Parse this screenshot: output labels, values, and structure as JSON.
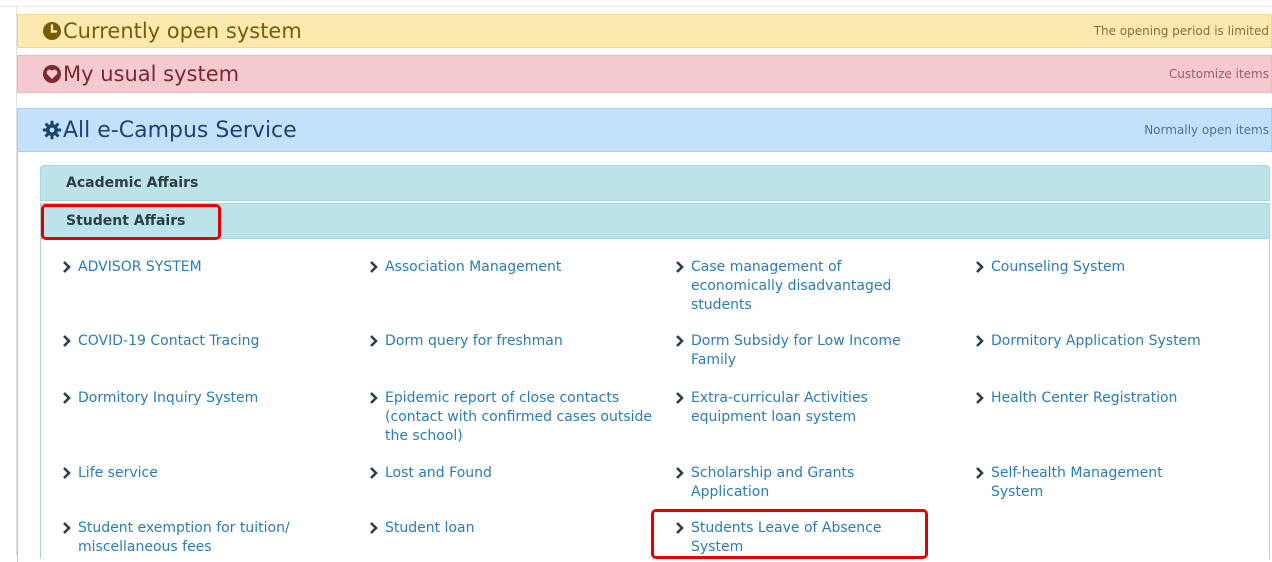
{
  "sections": {
    "currently_open": {
      "title": "Currently open system",
      "note": "The opening period is limited"
    },
    "usual": {
      "title": "My usual system",
      "note": "Customize items"
    },
    "all": {
      "title": "All e-Campus Service",
      "note": "Normally open items"
    }
  },
  "categories": {
    "academic": "Academic Affairs",
    "student": "Student Affairs"
  },
  "links": [
    "ADVISOR SYSTEM",
    "Association Management",
    "Case management of economically disadvantaged students",
    "Counseling System",
    "COVID-19 Contact Tracing",
    "Dorm query for freshman",
    "Dorm Subsidy for Low Income Family",
    "Dormitory Application System",
    "Dormitory Inquiry System",
    "Epidemic report of close contacts (contact with confirmed cases outside the school)",
    "Extra-curricular Activities equipment loan system",
    "Health Center Registration",
    "Life service",
    "Lost and Found",
    "Scholarship and Grants Application",
    "Self-health Management System",
    "Student exemption for tuition/ miscellaneous fees",
    "Student loan",
    "Students Leave of Absence System"
  ],
  "icons": {
    "open": "clock-icon",
    "usual": "heart-icon",
    "all": "gear-icon",
    "link": "chevron-right-icon"
  },
  "colors": {
    "link": "#2a7cb8",
    "highlight": "#e00000"
  }
}
